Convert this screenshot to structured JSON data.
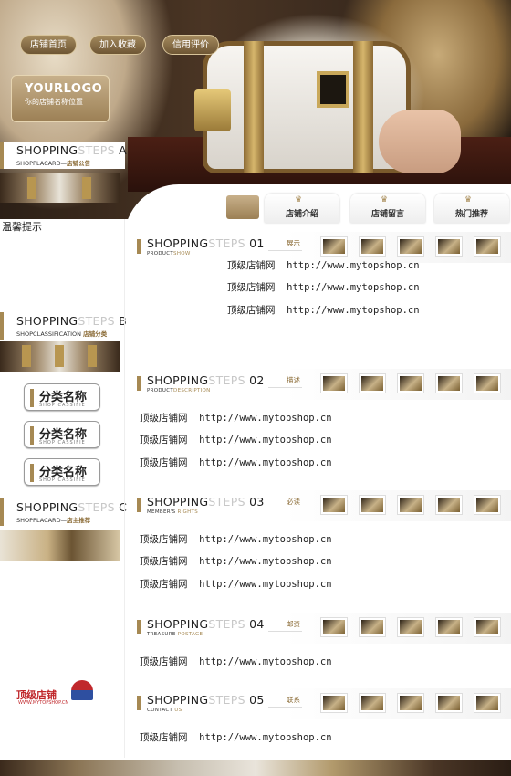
{
  "nav": {
    "items": [
      {
        "label": "店铺首页"
      },
      {
        "label": "加入收藏"
      },
      {
        "label": "信用评价"
      }
    ]
  },
  "logo": {
    "title": "YOURLOGO",
    "subtitle": "你的店铺名称位置"
  },
  "sidebar": {
    "a": {
      "title_main": "SHOPPING",
      "title_grey": "STEPS",
      "title_tail": " A",
      "sub_en": "SHOPPLACARD",
      "sub_cn": "店铺公告"
    },
    "warm_tip": "温馨提示",
    "b": {
      "title_main": "SHOPPING",
      "title_grey": "STEPS",
      "title_tail": " B",
      "sub_en": "SHOPCLASSIFICATION",
      "sub_cn": "店铺分类"
    },
    "categories": [
      {
        "label": "分类名称",
        "sub": "SHOP CASSIFIE"
      },
      {
        "label": "分类名称",
        "sub": "SHOP CASSIFIE"
      },
      {
        "label": "分类名称",
        "sub": "SHOP CASSIFIE"
      }
    ],
    "c": {
      "title_main": "SHOPPING",
      "title_grey": "STEPS",
      "title_tail": " C",
      "sub_en": "SHOPPLACARD",
      "sub_cn": "店主推荐"
    },
    "bottom_logo": {
      "text": "顶级店铺",
      "small": "WWW.MYTOPSHOP.CN"
    }
  },
  "tabs": [
    {
      "label": "店铺介绍"
    },
    {
      "label": "店铺留言"
    },
    {
      "label": "热门推荐"
    }
  ],
  "sections": [
    {
      "num": "01",
      "sub_a": "PRODUCT",
      "sub_b": "SHOW",
      "tag": "展示",
      "lines": [
        {
          "cn": "顶级店铺网",
          "url": "http://www.mytopshop.cn"
        },
        {
          "cn": "顶级店铺网",
          "url": "http://www.mytopshop.cn"
        },
        {
          "cn": "顶级店铺网",
          "url": "http://www.mytopshop.cn"
        }
      ]
    },
    {
      "num": "02",
      "sub_a": "PRODUCT",
      "sub_b": "DESCRIPTION",
      "tag": "描述",
      "lines": [
        {
          "cn": "顶级店铺网",
          "url": "http://www.mytopshop.cn"
        },
        {
          "cn": "顶级店铺网",
          "url": "http://www.mytopshop.cn"
        },
        {
          "cn": "顶级店铺网",
          "url": "http://www.mytopshop.cn"
        }
      ]
    },
    {
      "num": "03",
      "sub_a": "MEMBER'S",
      "sub_b": "RIGHTS",
      "tag": "必读",
      "lines": [
        {
          "cn": "顶级店铺网",
          "url": "http://www.mytopshop.cn"
        },
        {
          "cn": "顶级店铺网",
          "url": "http://www.mytopshop.cn"
        },
        {
          "cn": "顶级店铺网",
          "url": "http://www.mytopshop.cn"
        }
      ]
    },
    {
      "num": "04",
      "sub_a": "TREASURE",
      "sub_b": "POSTAGE",
      "tag": "邮资",
      "lines": [
        {
          "cn": "顶级店铺网",
          "url": "http://www.mytopshop.cn"
        }
      ]
    },
    {
      "num": "05",
      "sub_a": "CONTACT",
      "sub_b": "US",
      "tag": "联系",
      "lines": [
        {
          "cn": "顶级店铺网",
          "url": "http://www.mytopshop.cn"
        }
      ]
    }
  ],
  "section_title": {
    "main": "SHOPPING",
    "grey": "STEPS"
  }
}
